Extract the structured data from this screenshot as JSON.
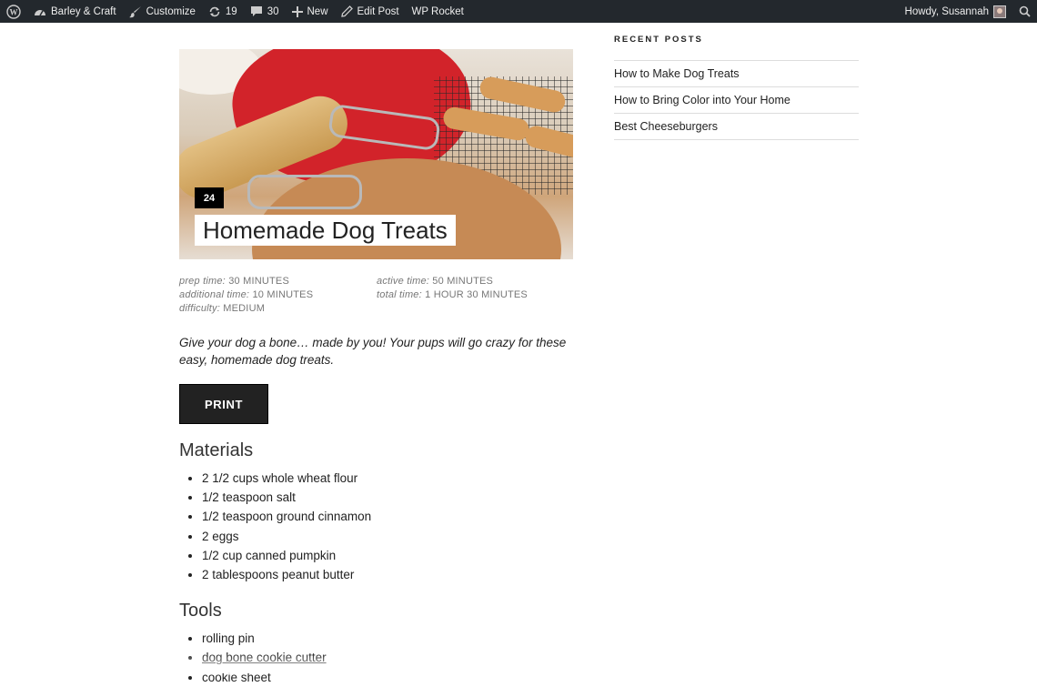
{
  "admin_bar": {
    "site_name": "Barley & Craft",
    "customize_label": "Customize",
    "updates_count": "19",
    "comments_count": "30",
    "new_label": "New",
    "edit_post_label": "Edit Post",
    "wp_rocket_label": "WP Rocket",
    "howdy_label": "Howdy, Susannah"
  },
  "recipe": {
    "badge": "24",
    "title": "Homemade Dog Treats",
    "meta": [
      {
        "label": "prep time:",
        "value": "30 MINUTES"
      },
      {
        "label": "active time:",
        "value": "50 MINUTES"
      },
      {
        "label": "additional time:",
        "value": "10 MINUTES"
      },
      {
        "label": "total time:",
        "value": "1 HOUR 30 MINUTES"
      },
      {
        "label": "difficulty:",
        "value": "MEDIUM"
      }
    ],
    "summary": "Give your dog a bone… made by you! Your pups will go crazy for these easy, homemade dog treats.",
    "print_label": "PRINT",
    "materials_heading": "Materials",
    "materials": [
      "2 1/2 cups whole wheat flour",
      "1/2 teaspoon salt",
      "1/2 teaspoon ground cinnamon",
      "2 eggs",
      "1/2 cup canned pumpkin",
      "2 tablespoons peanut butter"
    ],
    "tools_heading": "Tools",
    "tools": [
      "rolling pin",
      "dog bone cookie cutter",
      "cookie sheet"
    ]
  },
  "sidebar": {
    "recent_title": "RECENT POSTS",
    "recent_posts": [
      "How to Make Dog Treats",
      "How to Bring Color into Your Home",
      "Best Cheeseburgers"
    ]
  },
  "icons": {
    "wordpress": "wordpress-logo-icon",
    "dashboard": "dashboard-icon",
    "brush": "paintbrush-icon",
    "updates": "refresh-icon",
    "comments": "comment-bubble-icon",
    "plus": "plus-icon",
    "pencil": "pencil-icon",
    "search": "search-icon"
  }
}
